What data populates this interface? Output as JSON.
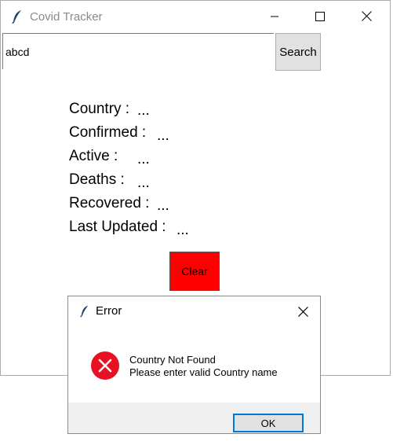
{
  "window": {
    "title": "Covid Tracker",
    "icon": "feather-icon",
    "controls": [
      "minimize-icon",
      "maximize-icon",
      "close-icon"
    ]
  },
  "search": {
    "value": "abcd",
    "button_label": "Search"
  },
  "info": [
    {
      "label": "Country :",
      "value": "..."
    },
    {
      "label": "Confirmed :",
      "value": "..."
    },
    {
      "label": "Active :",
      "value": "..."
    },
    {
      "label": "Deaths :",
      "value": "..."
    },
    {
      "label": "Recovered :",
      "value": "..."
    },
    {
      "label": "Last Updated :",
      "value": "..."
    }
  ],
  "clear_button": {
    "label": "Clear",
    "color": "#ff0000"
  },
  "dialog": {
    "title": "Error",
    "icon": "error-icon",
    "message_line1": "Country Not Found",
    "message_line2": "Please enter valid Country name",
    "ok_label": "OK"
  },
  "colors": {
    "accent": "#0078d7",
    "error": "#e81123"
  }
}
